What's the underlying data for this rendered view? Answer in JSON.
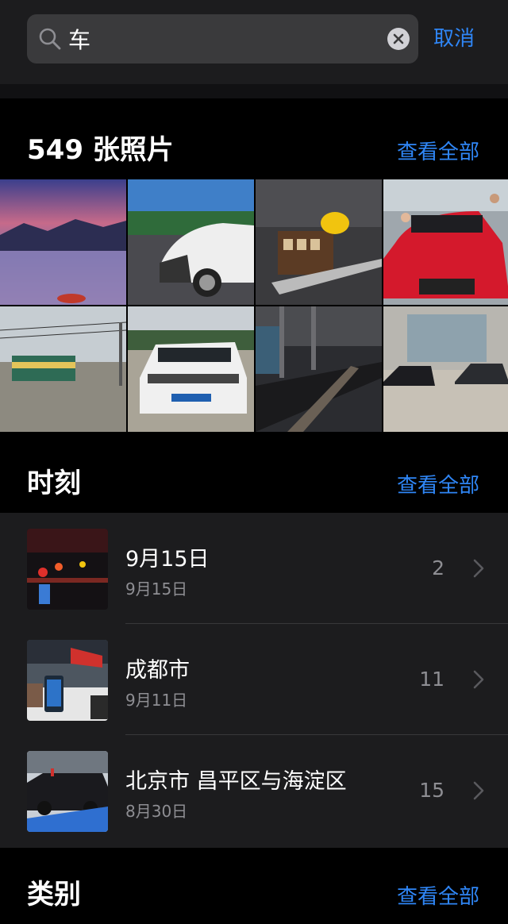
{
  "search": {
    "query": "车",
    "cancel_label": "取消"
  },
  "photos_section": {
    "title": "549 张照片",
    "see_all": "查看全部",
    "thumbnails": [
      {
        "subject": "lake-sunset"
      },
      {
        "subject": "white-car-wrapped"
      },
      {
        "subject": "toy-train-model"
      },
      {
        "subject": "red-bmw-people"
      },
      {
        "subject": "street-tram"
      },
      {
        "subject": "white-ford-suv"
      },
      {
        "subject": "subway-station"
      },
      {
        "subject": "dark-sports-cars"
      }
    ]
  },
  "moments_section": {
    "title": "时刻",
    "see_all": "查看全部",
    "items": [
      {
        "title": "9月15日",
        "date": "9月15日",
        "count": "2",
        "thumb": "night-street"
      },
      {
        "title": "成都市",
        "date": "9月11日",
        "count": "11",
        "thumb": "car-show"
      },
      {
        "title": "北京市 昌平区与海淀区",
        "date": "8月30日",
        "count": "15",
        "thumb": "black-limousine"
      }
    ]
  },
  "categories_section": {
    "title": "类别",
    "see_all": "查看全部"
  },
  "colors": {
    "accent": "#2f86f6",
    "background": "#000000",
    "panel": "#1c1c1e",
    "secondary_text": "#8e8e93"
  }
}
